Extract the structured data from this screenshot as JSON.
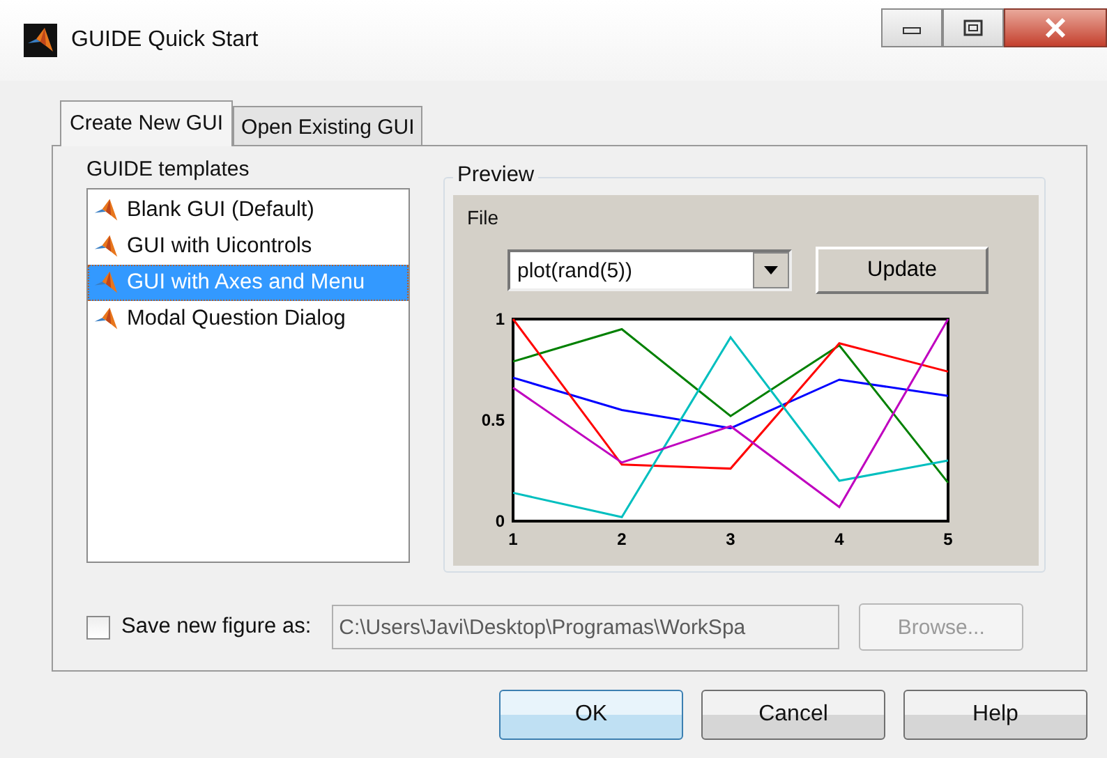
{
  "window": {
    "title": "GUIDE Quick Start"
  },
  "tabs": [
    {
      "label": "Create New GUI",
      "selected": true
    },
    {
      "label": "Open Existing GUI",
      "selected": false
    }
  ],
  "templates": {
    "label": "GUIDE templates",
    "items": [
      {
        "label": "Blank GUI (Default)",
        "selected": false
      },
      {
        "label": "GUI with Uicontrols",
        "selected": false
      },
      {
        "label": "GUI with Axes and Menu",
        "selected": true
      },
      {
        "label": "Modal Question Dialog",
        "selected": false
      }
    ]
  },
  "preview": {
    "label": "Preview",
    "menu": "File",
    "dropdown": "plot(rand(5))",
    "update_button": "Update",
    "chart_data": {
      "type": "line",
      "x": [
        1,
        2,
        3,
        4,
        5
      ],
      "xticks": [
        1,
        2,
        3,
        4,
        5
      ],
      "yticks": [
        0,
        {
          "value": 0.5,
          "label": "0.5"
        },
        1
      ],
      "xlim": [
        1,
        5
      ],
      "ylim": [
        0,
        1
      ],
      "series": [
        {
          "color": "#0000ff",
          "values": [
            0.71,
            0.55,
            0.46,
            0.7,
            0.62
          ]
        },
        {
          "color": "#008000",
          "values": [
            0.79,
            0.95,
            0.52,
            0.87,
            0.19
          ]
        },
        {
          "color": "#ff0000",
          "values": [
            1.0,
            0.28,
            0.26,
            0.88,
            0.74
          ]
        },
        {
          "color": "#00bfbf",
          "values": [
            0.14,
            0.02,
            0.91,
            0.2,
            0.3
          ]
        },
        {
          "color": "#bf00bf",
          "values": [
            0.66,
            0.29,
            0.47,
            0.07,
            1.0
          ]
        }
      ]
    }
  },
  "save": {
    "label": "Save new figure as:",
    "checked": false,
    "path": "C:\\Users\\Javi\\Desktop\\Programas\\WorkSpa",
    "path_disabled": true,
    "browse": "Browse...",
    "browse_disabled": true
  },
  "buttons": [
    {
      "label": "OK",
      "default": true
    },
    {
      "label": "Cancel",
      "default": false
    },
    {
      "label": "Help",
      "default": false
    }
  ]
}
